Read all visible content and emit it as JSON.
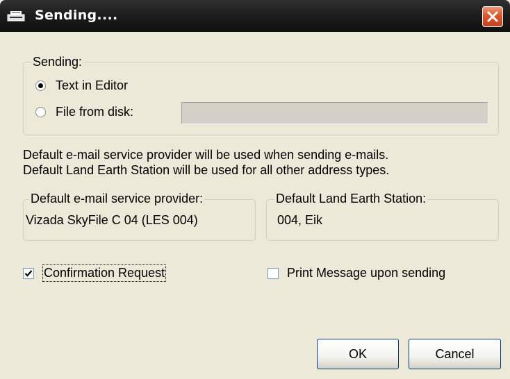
{
  "window": {
    "title": "Sending....",
    "icon": "printer-icon"
  },
  "sending_group": {
    "legend": "Sending:",
    "options": [
      {
        "label": "Text in Editor",
        "selected": true
      },
      {
        "label": "File from disk:",
        "selected": false
      }
    ],
    "file_path_value": ""
  },
  "info": {
    "line1": "Default e-mail service provider will be used when sending e-mails.",
    "line2": "Default Land Earth Station will be used for all other address types."
  },
  "provider_group": {
    "legend": "Default e-mail service provider:",
    "value": "Vizada SkyFile C 04 (LES 004)"
  },
  "les_group": {
    "legend": "Default Land Earth Station:",
    "value": "004, Eik"
  },
  "checkboxes": [
    {
      "label": "Confirmation Request",
      "checked": true
    },
    {
      "label": "Print Message upon sending",
      "checked": false
    }
  ],
  "buttons": {
    "ok": "OK",
    "cancel": "Cancel"
  },
  "colors": {
    "titlebar": "#1c1c1c",
    "close_button": "#d8572f",
    "dialog_bg": "#ece9d8"
  }
}
